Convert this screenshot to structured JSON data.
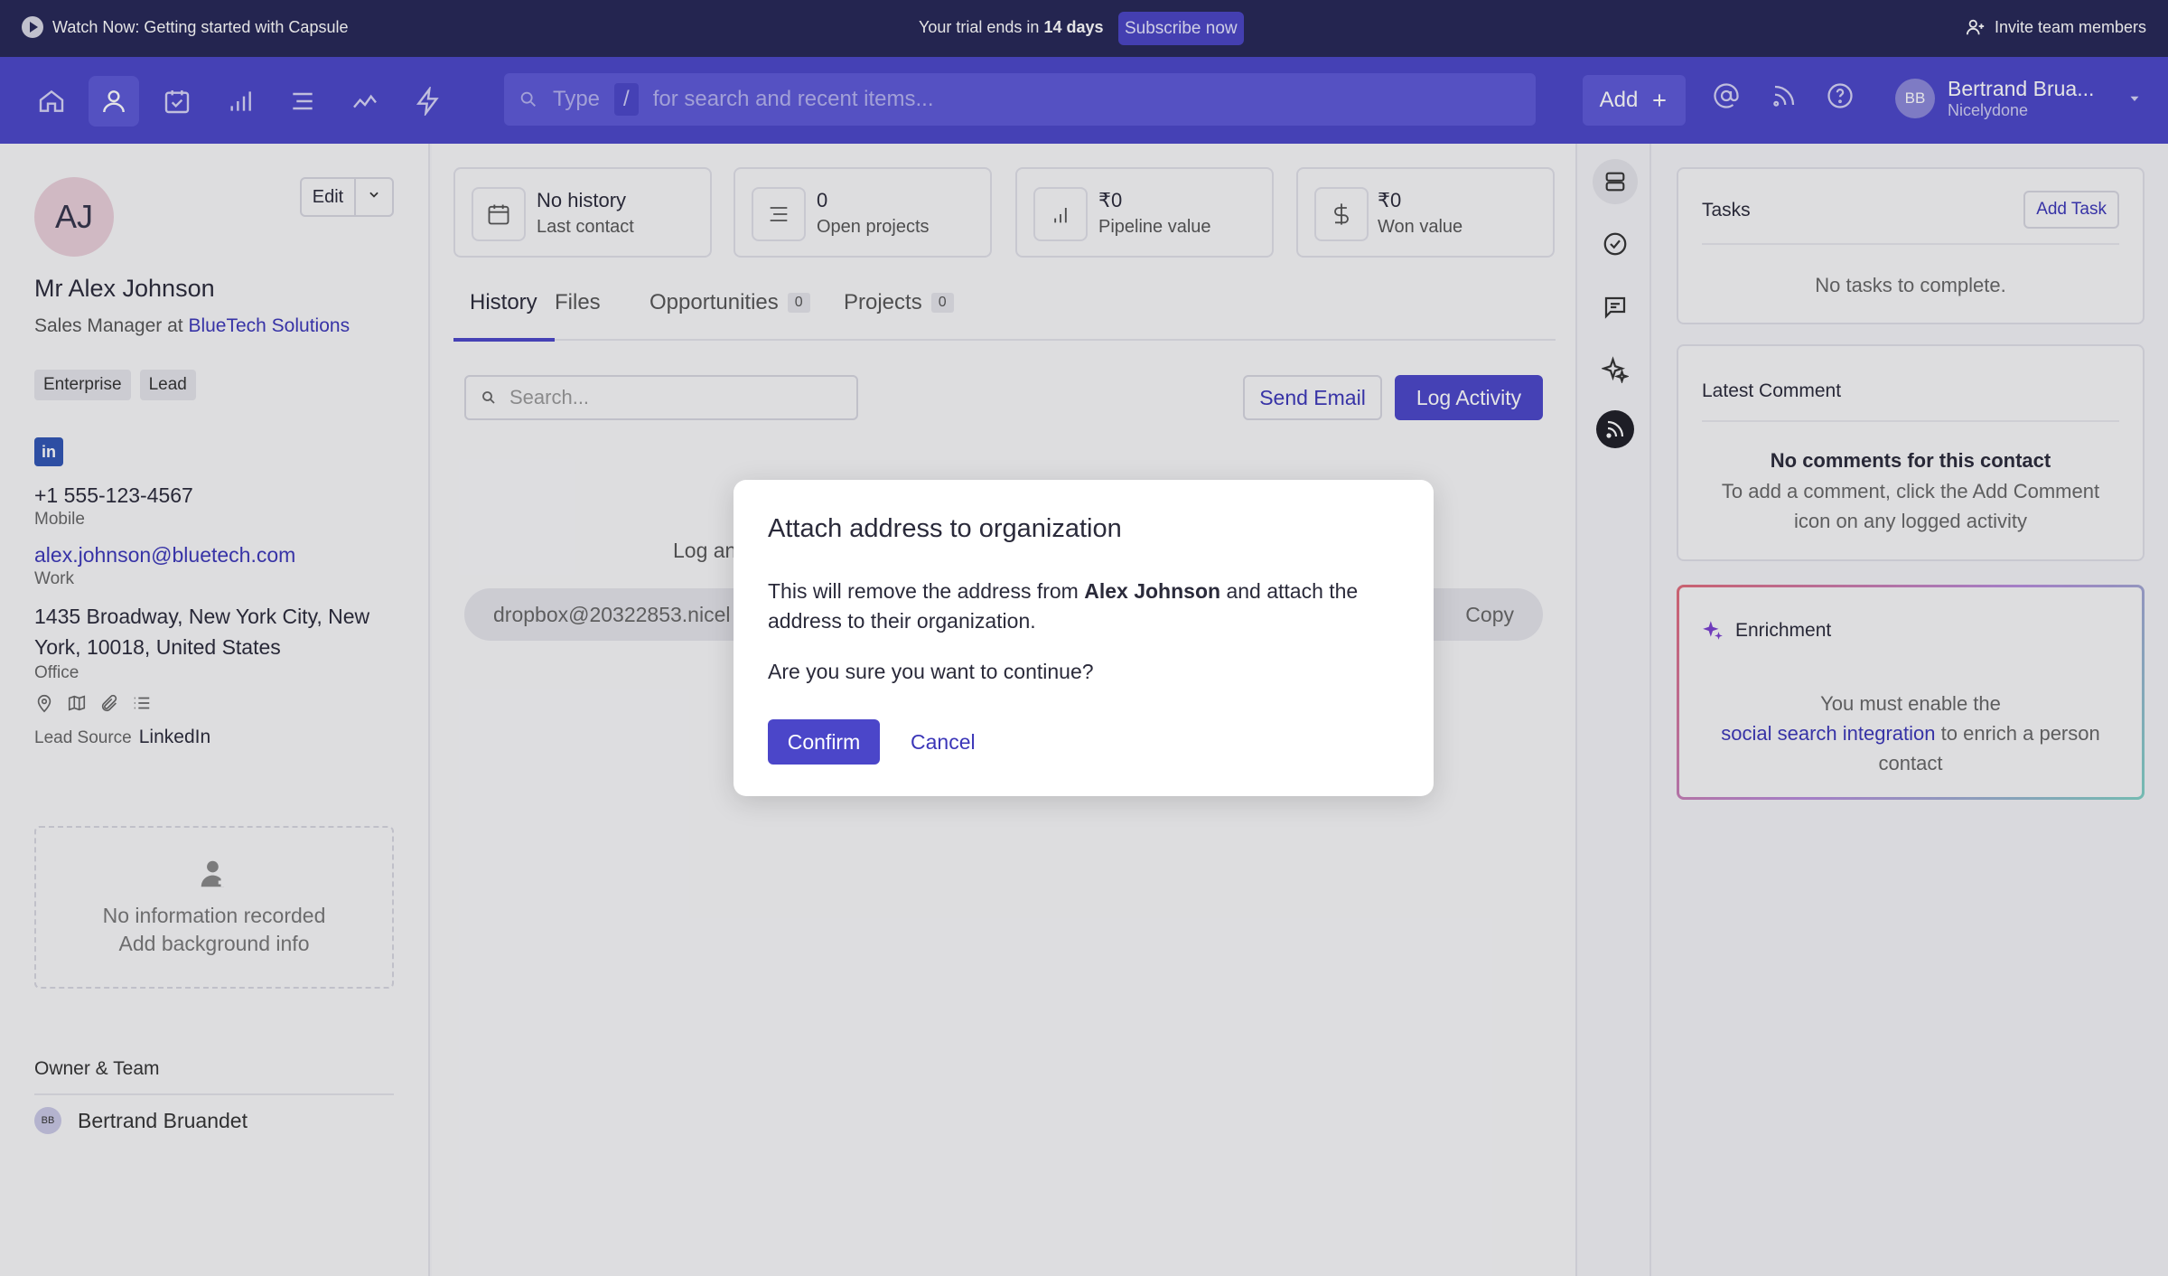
{
  "banner": {
    "watch_label": "Watch Now: Getting started with Capsule",
    "trial_prefix": "Your trial ends in",
    "trial_days": "14 days",
    "subscribe_label": "Subscribe now",
    "invite_label": "Invite team members"
  },
  "nav": {
    "search_prefix": "Type",
    "search_slash": "/",
    "search_placeholder": "for search and recent items...",
    "add_label": "Add",
    "user_initials": "BB",
    "user_name": "Bertrand Brua...",
    "user_org": "Nicelydone"
  },
  "contact": {
    "initials": "AJ",
    "edit_label": "Edit",
    "name": "Mr Alex Johnson",
    "title_prefix": "Sales Manager at",
    "company": "BlueTech Solutions",
    "tags": [
      "Enterprise",
      "Lead"
    ],
    "linkedin_glyph": "in",
    "phone": "+1 555-123-4567",
    "phone_type": "Mobile",
    "email": "alex.johnson@bluetech.com",
    "email_type": "Work",
    "address_line1": "1435 Broadway, New York City, New",
    "address_line2": "York, 10018, United States",
    "address_type": "Office",
    "lead_source_label": "Lead Source",
    "lead_source": "LinkedIn",
    "bg_line1": "No information recorded",
    "bg_line2": "Add background info",
    "owner_heading": "Owner & Team",
    "owner_initials": "BB",
    "owner_name": "Bertrand Bruandet"
  },
  "stats": [
    {
      "value": "No history",
      "label": "Last contact"
    },
    {
      "value": "0",
      "label": "Open projects"
    },
    {
      "value": "₹0",
      "label": "Pipeline value"
    },
    {
      "value": "₹0",
      "label": "Won value"
    }
  ],
  "tabs": {
    "history": "History",
    "files": "Files",
    "opportunities": "Opportunities",
    "opportunities_count": "0",
    "projects": "Projects",
    "projects_count": "0"
  },
  "history": {
    "search_placeholder": "Search...",
    "send_email_label": "Send Email",
    "log_activity_label": "Log Activity",
    "log_text": "Log an",
    "dropbox_address": "dropbox@20322853.nicel",
    "copy_label": "Copy"
  },
  "tasks": {
    "heading": "Tasks",
    "add_label": "Add Task",
    "empty": "No tasks to complete."
  },
  "comment": {
    "heading": "Latest Comment",
    "empty_title": "No comments for this contact",
    "empty_line1": "To add a comment, click the Add Comment",
    "empty_line2": "icon on any logged activity"
  },
  "enrichment": {
    "heading": "Enrichment",
    "line1": "You must enable the",
    "link": "social search integration",
    "line2_suffix": "to enrich a person",
    "line3": "contact"
  },
  "modal": {
    "title": "Attach address to organization",
    "body_prefix": "This will remove the address from",
    "body_name": "Alex Johnson",
    "body_suffix": "and attach the address to their organization.",
    "question": "Are you sure you want to continue?",
    "confirm_label": "Confirm",
    "cancel_label": "Cancel"
  },
  "colors": {
    "banner_bg": "#252656",
    "nav_bg": "#4b46c9",
    "accent": "#4b46c9",
    "link": "#3b36b8"
  }
}
